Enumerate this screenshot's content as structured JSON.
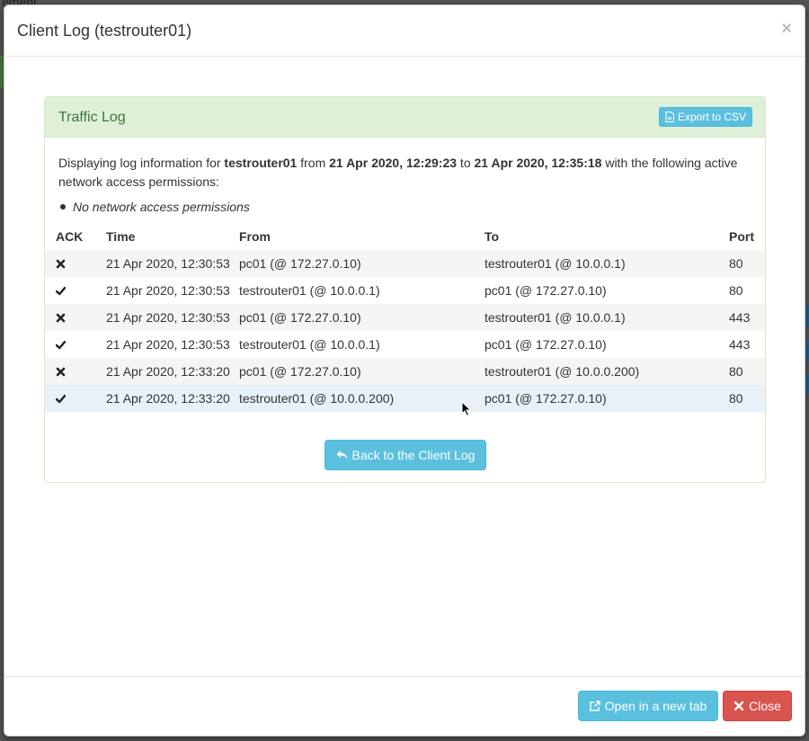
{
  "background": {
    "partial_text": "ement"
  },
  "modal": {
    "title": "Client Log (testrouter01)",
    "close_x": "×"
  },
  "panel": {
    "title": "Traffic Log",
    "export_label": "Export to CSV",
    "intro": {
      "p1": "Displaying log information for ",
      "client": "testrouter01",
      "p2": " from ",
      "from_time": "21 Apr 2020, 12:29:23",
      "p3": " to ",
      "to_time": "21 Apr 2020, 12:35:18",
      "p4": " with the following active network access permissions:"
    },
    "permission": "No network access permissions",
    "table": {
      "headers": [
        "ACK",
        "Time",
        "From",
        "To",
        "Port"
      ],
      "rows": [
        {
          "ack": "cross",
          "time": "21 Apr 2020, 12:30:53",
          "from": "pc01 (@ 172.27.0.10)",
          "to": "testrouter01 (@ 10.0.0.1)",
          "port": "80"
        },
        {
          "ack": "check",
          "time": "21 Apr 2020, 12:30:53",
          "from": "testrouter01 (@ 10.0.0.1)",
          "to": "pc01 (@ 172.27.0.10)",
          "port": "80"
        },
        {
          "ack": "cross",
          "time": "21 Apr 2020, 12:30:53",
          "from": "pc01 (@ 172.27.0.10)",
          "to": "testrouter01 (@ 10.0.0.1)",
          "port": "443"
        },
        {
          "ack": "check",
          "time": "21 Apr 2020, 12:30:53",
          "from": "testrouter01 (@ 10.0.0.1)",
          "to": "pc01 (@ 172.27.0.10)",
          "port": "443"
        },
        {
          "ack": "cross",
          "time": "21 Apr 2020, 12:33:20",
          "from": "pc01 (@ 172.27.0.10)",
          "to": "testrouter01 (@ 10.0.0.200)",
          "port": "80"
        },
        {
          "ack": "check",
          "time": "21 Apr 2020, 12:33:20",
          "from": "testrouter01 (@ 10.0.0.200)",
          "to": "pc01 (@ 172.27.0.10)",
          "port": "80"
        }
      ]
    },
    "back_label": "Back to the Client Log"
  },
  "footer": {
    "open_new_tab_label": "Open in a new tab",
    "close_label": "Close"
  },
  "colors": {
    "info": "#5bc0de",
    "danger": "#d9534f",
    "success_bg": "#dff0d8",
    "success_text": "#3c763d"
  }
}
